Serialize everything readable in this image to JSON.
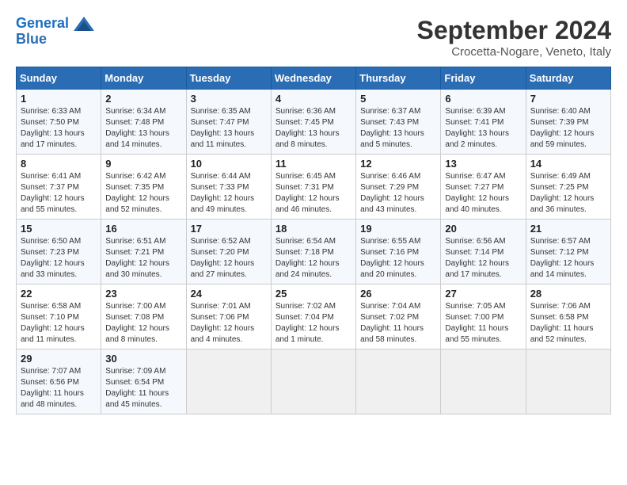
{
  "header": {
    "logo_line1": "General",
    "logo_line2": "Blue",
    "month_title": "September 2024",
    "location": "Crocetta-Nogare, Veneto, Italy"
  },
  "weekdays": [
    "Sunday",
    "Monday",
    "Tuesday",
    "Wednesday",
    "Thursday",
    "Friday",
    "Saturday"
  ],
  "weeks": [
    [
      {
        "day": "1",
        "info": "Sunrise: 6:33 AM\nSunset: 7:50 PM\nDaylight: 13 hours and 17 minutes."
      },
      {
        "day": "2",
        "info": "Sunrise: 6:34 AM\nSunset: 7:48 PM\nDaylight: 13 hours and 14 minutes."
      },
      {
        "day": "3",
        "info": "Sunrise: 6:35 AM\nSunset: 7:47 PM\nDaylight: 13 hours and 11 minutes."
      },
      {
        "day": "4",
        "info": "Sunrise: 6:36 AM\nSunset: 7:45 PM\nDaylight: 13 hours and 8 minutes."
      },
      {
        "day": "5",
        "info": "Sunrise: 6:37 AM\nSunset: 7:43 PM\nDaylight: 13 hours and 5 minutes."
      },
      {
        "day": "6",
        "info": "Sunrise: 6:39 AM\nSunset: 7:41 PM\nDaylight: 13 hours and 2 minutes."
      },
      {
        "day": "7",
        "info": "Sunrise: 6:40 AM\nSunset: 7:39 PM\nDaylight: 12 hours and 59 minutes."
      }
    ],
    [
      {
        "day": "8",
        "info": "Sunrise: 6:41 AM\nSunset: 7:37 PM\nDaylight: 12 hours and 55 minutes."
      },
      {
        "day": "9",
        "info": "Sunrise: 6:42 AM\nSunset: 7:35 PM\nDaylight: 12 hours and 52 minutes."
      },
      {
        "day": "10",
        "info": "Sunrise: 6:44 AM\nSunset: 7:33 PM\nDaylight: 12 hours and 49 minutes."
      },
      {
        "day": "11",
        "info": "Sunrise: 6:45 AM\nSunset: 7:31 PM\nDaylight: 12 hours and 46 minutes."
      },
      {
        "day": "12",
        "info": "Sunrise: 6:46 AM\nSunset: 7:29 PM\nDaylight: 12 hours and 43 minutes."
      },
      {
        "day": "13",
        "info": "Sunrise: 6:47 AM\nSunset: 7:27 PM\nDaylight: 12 hours and 40 minutes."
      },
      {
        "day": "14",
        "info": "Sunrise: 6:49 AM\nSunset: 7:25 PM\nDaylight: 12 hours and 36 minutes."
      }
    ],
    [
      {
        "day": "15",
        "info": "Sunrise: 6:50 AM\nSunset: 7:23 PM\nDaylight: 12 hours and 33 minutes."
      },
      {
        "day": "16",
        "info": "Sunrise: 6:51 AM\nSunset: 7:21 PM\nDaylight: 12 hours and 30 minutes."
      },
      {
        "day": "17",
        "info": "Sunrise: 6:52 AM\nSunset: 7:20 PM\nDaylight: 12 hours and 27 minutes."
      },
      {
        "day": "18",
        "info": "Sunrise: 6:54 AM\nSunset: 7:18 PM\nDaylight: 12 hours and 24 minutes."
      },
      {
        "day": "19",
        "info": "Sunrise: 6:55 AM\nSunset: 7:16 PM\nDaylight: 12 hours and 20 minutes."
      },
      {
        "day": "20",
        "info": "Sunrise: 6:56 AM\nSunset: 7:14 PM\nDaylight: 12 hours and 17 minutes."
      },
      {
        "day": "21",
        "info": "Sunrise: 6:57 AM\nSunset: 7:12 PM\nDaylight: 12 hours and 14 minutes."
      }
    ],
    [
      {
        "day": "22",
        "info": "Sunrise: 6:58 AM\nSunset: 7:10 PM\nDaylight: 12 hours and 11 minutes."
      },
      {
        "day": "23",
        "info": "Sunrise: 7:00 AM\nSunset: 7:08 PM\nDaylight: 12 hours and 8 minutes."
      },
      {
        "day": "24",
        "info": "Sunrise: 7:01 AM\nSunset: 7:06 PM\nDaylight: 12 hours and 4 minutes."
      },
      {
        "day": "25",
        "info": "Sunrise: 7:02 AM\nSunset: 7:04 PM\nDaylight: 12 hours and 1 minute."
      },
      {
        "day": "26",
        "info": "Sunrise: 7:04 AM\nSunset: 7:02 PM\nDaylight: 11 hours and 58 minutes."
      },
      {
        "day": "27",
        "info": "Sunrise: 7:05 AM\nSunset: 7:00 PM\nDaylight: 11 hours and 55 minutes."
      },
      {
        "day": "28",
        "info": "Sunrise: 7:06 AM\nSunset: 6:58 PM\nDaylight: 11 hours and 52 minutes."
      }
    ],
    [
      {
        "day": "29",
        "info": "Sunrise: 7:07 AM\nSunset: 6:56 PM\nDaylight: 11 hours and 48 minutes."
      },
      {
        "day": "30",
        "info": "Sunrise: 7:09 AM\nSunset: 6:54 PM\nDaylight: 11 hours and 45 minutes."
      },
      {
        "day": "",
        "info": ""
      },
      {
        "day": "",
        "info": ""
      },
      {
        "day": "",
        "info": ""
      },
      {
        "day": "",
        "info": ""
      },
      {
        "day": "",
        "info": ""
      }
    ]
  ]
}
